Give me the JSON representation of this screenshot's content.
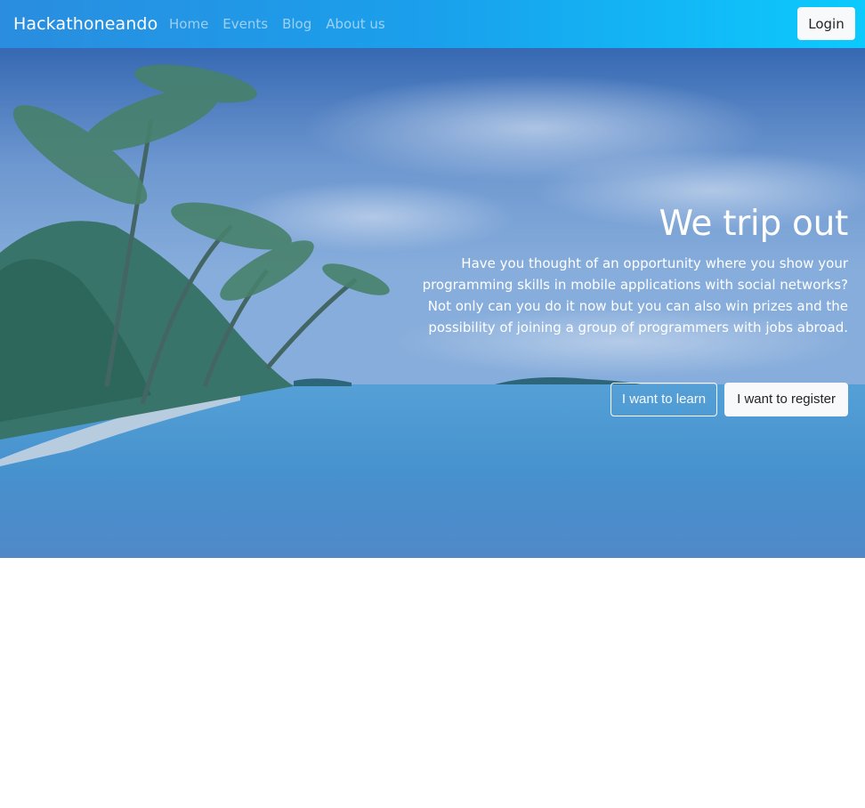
{
  "navbar": {
    "brand": "Hackathoneando",
    "links": [
      "Home",
      "Events",
      "Blog",
      "About us"
    ],
    "login_label": "Login"
  },
  "hero": {
    "title": "We trip out",
    "text_lines": [
      "Have you thought of an opportunity where you show your",
      "programming skills in mobile applications with social networks?",
      "Not only can you do it now but you can also win prizes and the",
      "possibility of joining a group of programmers with jobs abroad."
    ],
    "learn_label": "I want to learn",
    "register_label": "I want to register",
    "background_image": "tropical-beach-palm-trees"
  },
  "colors": {
    "navbar_gradient_start": "#2a8ddf",
    "navbar_gradient_end": "#0ccafd",
    "button_light": "#f8f9fa",
    "text_dark": "#212529"
  }
}
